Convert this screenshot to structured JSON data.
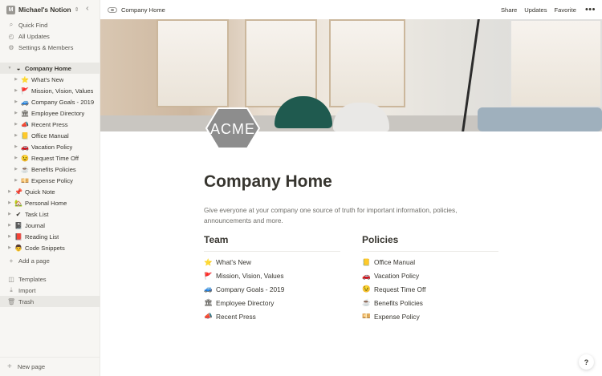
{
  "workspace": {
    "name": "Michael's Notion",
    "avatar_letter": "M"
  },
  "sidebar": {
    "nav": [
      {
        "label": "Quick Find",
        "icon": "search-icon",
        "glyph": "⌕"
      },
      {
        "label": "All Updates",
        "icon": "clock-icon",
        "glyph": "◴"
      },
      {
        "label": "Settings & Members",
        "icon": "gear-icon",
        "glyph": "⚙"
      }
    ],
    "pages": [
      {
        "label": "Company Home",
        "emoji": "◒",
        "expanded": true,
        "selected": true
      },
      {
        "label": "What's New",
        "emoji": "⭐",
        "child": true
      },
      {
        "label": "Mission, Vision, Values",
        "emoji": "🚩",
        "child": true
      },
      {
        "label": "Company Goals - 2019",
        "emoji": "🚙",
        "child": true
      },
      {
        "label": "Employee Directory",
        "emoji": "🏛",
        "child": true
      },
      {
        "label": "Recent Press",
        "emoji": "📣",
        "child": true
      },
      {
        "label": "Office Manual",
        "emoji": "📒",
        "child": true
      },
      {
        "label": "Vacation Policy",
        "emoji": "🚗",
        "child": true
      },
      {
        "label": "Request Time Off",
        "emoji": "😉",
        "child": true
      },
      {
        "label": "Benefits Policies",
        "emoji": "☕",
        "child": true
      },
      {
        "label": "Expense Policy",
        "emoji": "💴",
        "child": true
      },
      {
        "label": "Quick Note",
        "emoji": "📌"
      },
      {
        "label": "Personal Home",
        "emoji": "🏡"
      },
      {
        "label": "Task List",
        "emoji": "✔"
      },
      {
        "label": "Journal",
        "emoji": "📓"
      },
      {
        "label": "Reading List",
        "emoji": "📕"
      },
      {
        "label": "Code Snippets",
        "emoji": "👨"
      }
    ],
    "add_page": "Add a page",
    "bottom": [
      {
        "label": "Templates",
        "icon": "templates-icon",
        "glyph": "◫"
      },
      {
        "label": "Import",
        "icon": "import-icon",
        "glyph": "⤓"
      },
      {
        "label": "Trash",
        "icon": "trash-icon",
        "glyph": "🗑"
      }
    ],
    "new_page": "New page"
  },
  "topbar": {
    "breadcrumb": "Company Home",
    "share": "Share",
    "updates": "Updates",
    "favorite": "Favorite",
    "more": "•••"
  },
  "page": {
    "logo_text": "ACME",
    "title": "Company Home",
    "description": "Give everyone at your company one source of truth for important information, policies, announcements and more.",
    "team": {
      "heading": "Team",
      "items": [
        {
          "emoji": "⭐",
          "label": "What's New"
        },
        {
          "emoji": "🚩",
          "label": "Mission, Vision, Values"
        },
        {
          "emoji": "🚙",
          "label": "Company Goals - 2019"
        },
        {
          "emoji": "🏛",
          "label": "Employee Directory"
        },
        {
          "emoji": "📣",
          "label": "Recent Press"
        }
      ]
    },
    "policies": {
      "heading": "Policies",
      "items": [
        {
          "emoji": "📒",
          "label": "Office Manual"
        },
        {
          "emoji": "🚗",
          "label": "Vacation Policy"
        },
        {
          "emoji": "😉",
          "label": "Request Time Off"
        },
        {
          "emoji": "☕",
          "label": "Benefits Policies"
        },
        {
          "emoji": "💴",
          "label": "Expense Policy"
        }
      ]
    }
  },
  "help_label": "?"
}
